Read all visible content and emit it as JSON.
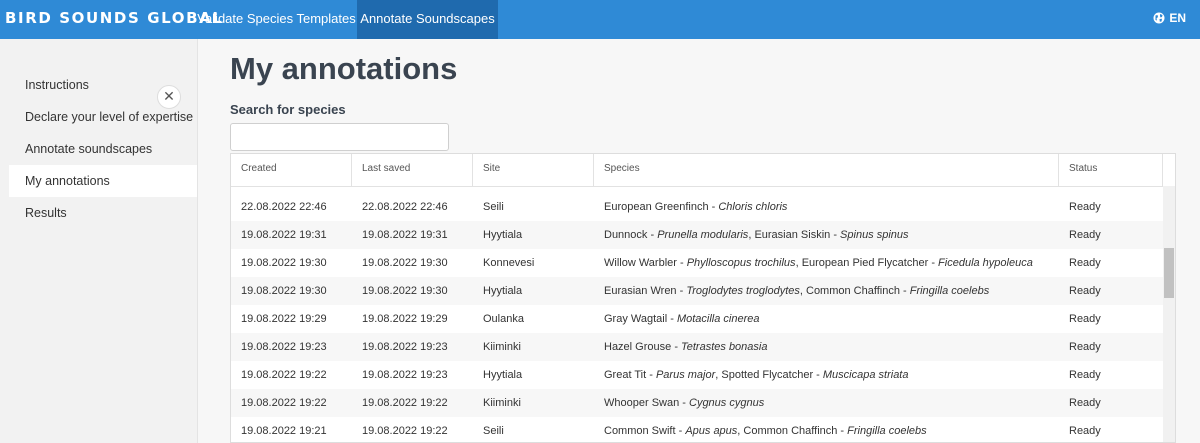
{
  "app": {
    "brand": "BIRD SOUNDS GLOBAL"
  },
  "nav": {
    "tabs": [
      {
        "label": "Validate Species Templates"
      },
      {
        "label": "Annotate Soundscapes"
      }
    ],
    "language": "EN"
  },
  "sidebar": {
    "items": [
      {
        "label": "Instructions"
      },
      {
        "label": "Declare your level of expertise"
      },
      {
        "label": "Annotate soundscapes"
      },
      {
        "label": "My annotations"
      },
      {
        "label": "Results"
      }
    ]
  },
  "main": {
    "title": "My annotations",
    "search_label": "Search for species",
    "search_value": "",
    "columns": [
      "Created",
      "Last saved",
      "Site",
      "Species",
      "Status"
    ],
    "rows": [
      {
        "created": "22.08.2022 22:46",
        "saved": "22.08.2022 22:46",
        "site": "Seili",
        "species": [
          [
            "European Greenfinch",
            "Chloris chloris"
          ]
        ],
        "status": "Ready"
      },
      {
        "created": "19.08.2022 19:31",
        "saved": "19.08.2022 19:31",
        "site": "Hyytiala",
        "species": [
          [
            "Dunnock",
            "Prunella modularis"
          ],
          [
            "Eurasian Siskin",
            "Spinus spinus"
          ]
        ],
        "status": "Ready"
      },
      {
        "created": "19.08.2022 19:30",
        "saved": "19.08.2022 19:30",
        "site": "Konnevesi",
        "species": [
          [
            "Willow Warbler",
            "Phylloscopus trochilus"
          ],
          [
            "European Pied Flycatcher",
            "Ficedula hypoleuca"
          ]
        ],
        "status": "Ready"
      },
      {
        "created": "19.08.2022 19:30",
        "saved": "19.08.2022 19:30",
        "site": "Hyytiala",
        "species": [
          [
            "Eurasian Wren",
            "Troglodytes troglodytes"
          ],
          [
            "Common Chaffinch",
            "Fringilla coelebs"
          ]
        ],
        "status": "Ready"
      },
      {
        "created": "19.08.2022 19:29",
        "saved": "19.08.2022 19:29",
        "site": "Oulanka",
        "species": [
          [
            "Gray Wagtail",
            "Motacilla cinerea"
          ]
        ],
        "status": "Ready"
      },
      {
        "created": "19.08.2022 19:23",
        "saved": "19.08.2022 19:23",
        "site": "Kiiminki",
        "species": [
          [
            "Hazel Grouse",
            "Tetrastes bonasia"
          ]
        ],
        "status": "Ready"
      },
      {
        "created": "19.08.2022 19:22",
        "saved": "19.08.2022 19:23",
        "site": "Hyytiala",
        "species": [
          [
            "Great Tit",
            "Parus major"
          ],
          [
            "Spotted Flycatcher",
            "Muscicapa striata"
          ]
        ],
        "status": "Ready"
      },
      {
        "created": "19.08.2022 19:22",
        "saved": "19.08.2022 19:22",
        "site": "Kiiminki",
        "species": [
          [
            "Whooper Swan",
            "Cygnus cygnus"
          ]
        ],
        "status": "Ready"
      },
      {
        "created": "19.08.2022 19:21",
        "saved": "19.08.2022 19:22",
        "site": "Seili",
        "species": [
          [
            "Common Swift",
            "Apus apus"
          ],
          [
            "Common Chaffinch",
            "Fringilla coelebs"
          ]
        ],
        "status": "Ready"
      }
    ]
  },
  "icons": {
    "close": "close-icon",
    "language": "globe-icon"
  },
  "colors": {
    "topbar": "#2f8ad6",
    "active_tab": "#1f6aae",
    "title": "#3a4450"
  }
}
